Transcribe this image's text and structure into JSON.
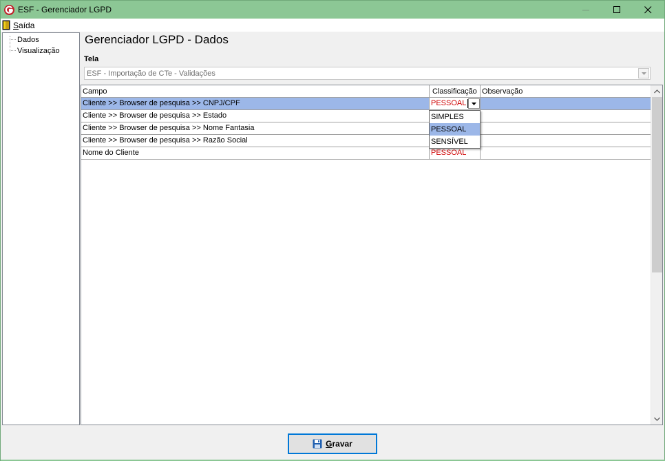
{
  "window": {
    "title": "ESF - Gerenciador LGPD",
    "titlebar_color": "#8cc795",
    "icons": [
      "app-logo-icon",
      "minimize-icon",
      "maximize-icon",
      "close-icon"
    ]
  },
  "menu": {
    "items": [
      {
        "label": "Saída",
        "icon": "exit-door-icon"
      }
    ]
  },
  "tree": {
    "items": [
      {
        "label": "Dados"
      },
      {
        "label": "Visualização"
      }
    ]
  },
  "main": {
    "heading": "Gerenciador LGPD - Dados",
    "tela_label": "Tela",
    "tela_value": "ESF - Importação de CTe - Validações"
  },
  "grid": {
    "columns": [
      "Campo",
      "Classificação",
      "Observação"
    ],
    "rows": [
      {
        "campo": "Cliente >> Browser de pesquisa >> CNPJ/CPF",
        "classificacao": "PESSOAL",
        "observacao": "",
        "selected": true
      },
      {
        "campo": "Cliente >> Browser de pesquisa >> Estado",
        "classificacao": "",
        "observacao": ""
      },
      {
        "campo": "Cliente >> Browser de pesquisa >> Nome Fantasia",
        "classificacao": "",
        "observacao": ""
      },
      {
        "campo": "Cliente >> Browser de pesquisa >> Razão Social",
        "classificacao": "",
        "observacao": ""
      },
      {
        "campo": "Nome do Cliente",
        "classificacao": "PESSOAL",
        "observacao": ""
      }
    ],
    "dropdown_options": [
      "SIMPLES",
      "PESSOAL",
      "SENSÍVEL"
    ],
    "dropdown_highlighted": "PESSOAL",
    "selection_color": "#9cb7e8",
    "classification_color": "#d00000"
  },
  "footer": {
    "save_label": "Gravar",
    "save_icon": "floppy-disk-icon"
  }
}
